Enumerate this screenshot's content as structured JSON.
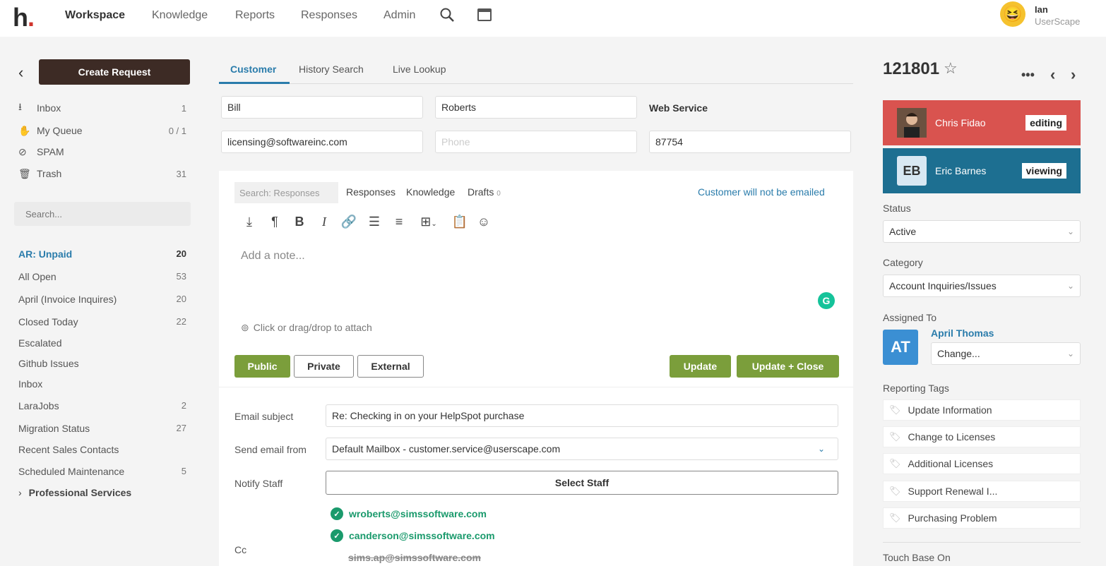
{
  "app": {
    "logo": "h",
    "nav": [
      "Workspace",
      "Knowledge",
      "Reports",
      "Responses",
      "Admin"
    ],
    "user": {
      "name": "Ian",
      "org": "UserScape",
      "avatar": "😆"
    }
  },
  "sidebar": {
    "create_label": "Create Request",
    "mailboxes": [
      {
        "icon": "inbox-icon",
        "label": "Inbox",
        "count": "1"
      },
      {
        "icon": "hand-icon",
        "label": "My Queue",
        "count": "0 / 1"
      },
      {
        "icon": "spam-icon",
        "label": "SPAM",
        "count": ""
      },
      {
        "icon": "trash-icon",
        "label": "Trash",
        "count": "31"
      }
    ],
    "search_placeholder": "Search...",
    "filters": [
      {
        "label": "AR: Unpaid",
        "count": "20",
        "active": true
      },
      {
        "label": "All Open",
        "count": "53"
      },
      {
        "label": "April (Invoice Inquires)",
        "count": "20"
      },
      {
        "label": "Closed Today",
        "count": "22"
      },
      {
        "label": "Escalated",
        "count": ""
      },
      {
        "label": "Github Issues",
        "count": ""
      },
      {
        "label": "Inbox",
        "count": ""
      },
      {
        "label": "LaraJobs",
        "count": "2"
      },
      {
        "label": "Migration Status",
        "count": "27"
      },
      {
        "label": "Recent Sales Contacts",
        "count": ""
      },
      {
        "label": "Scheduled Maintenance",
        "count": "5"
      }
    ],
    "group": "Professional Services"
  },
  "customer": {
    "tabs": [
      "Customer",
      "History Search",
      "Live Lookup"
    ],
    "first_name": "Bill",
    "last_name": "Roberts",
    "service": "Web Service",
    "email": "licensing@softwareinc.com",
    "phone_placeholder": "Phone",
    "customer_id": "87754"
  },
  "editor": {
    "search_placeholder": "Search: Responses",
    "tabs": [
      "Responses",
      "Knowledge",
      "Drafts"
    ],
    "drafts_count": "0",
    "notify_msg": "Customer will not be emailed",
    "toolbar": [
      "download-icon",
      "paragraph-icon",
      "bold-icon",
      "italic-icon",
      "link-icon",
      "bullet-list-icon",
      "numbered-list-icon",
      "table-icon",
      "paste-icon",
      "emoji-icon"
    ],
    "note_placeholder": "Add a note...",
    "grammarly": "G",
    "attach": "Click or drag/drop to attach",
    "buttons": {
      "public": "Public",
      "private": "Private",
      "external": "External",
      "update": "Update",
      "update_close": "Update + Close"
    }
  },
  "email": {
    "subject_label": "Email subject",
    "subject": "Re: Checking in on your HelpSpot purchase",
    "from_label": "Send email from",
    "from": "Default Mailbox - customer.service@userscape.com",
    "notify_label": "Notify Staff",
    "select_staff": "Select Staff",
    "cc_label": "Cc",
    "cc": [
      "wroberts@simssoftware.com",
      "canderson@simssoftware.com"
    ],
    "cc_struck": "sims.ap@simssoftware.com"
  },
  "request": {
    "id": "121801",
    "viewers": [
      {
        "name": "Chris Fidao",
        "state": "editing",
        "color": "#d9534f"
      },
      {
        "name": "Eric Barnes",
        "initials": "EB",
        "state": "viewing",
        "color": "#1d6f91"
      }
    ],
    "status_label": "Status",
    "status": "Active",
    "category_label": "Category",
    "category": "Account Inquiries/Issues",
    "assigned_label": "Assigned To",
    "assigned_initials": "AT",
    "assigned_name": "April Thomas",
    "assigned_change": "Change...",
    "tags_label": "Reporting Tags",
    "tags": [
      "Update Information",
      "Change to Licenses",
      "Additional Licenses",
      "Support Renewal I...",
      "Purchasing Problem"
    ],
    "touch_base": "Touch Base On"
  }
}
